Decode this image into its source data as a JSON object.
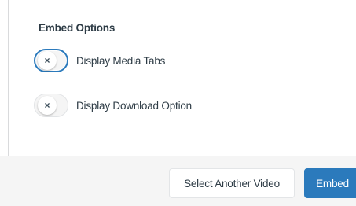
{
  "embed_options": {
    "title": "Embed Options",
    "options": [
      {
        "label": "Display Media Tabs",
        "toggle_icon": "x-icon",
        "toggle_glyph": "×",
        "checked": false,
        "focused": true
      },
      {
        "label": "Display Download Option",
        "toggle_icon": "x-icon",
        "toggle_glyph": "×",
        "checked": false,
        "focused": false
      }
    ]
  },
  "footer": {
    "select_another_label": "Select Another Video",
    "embed_label": "Embed"
  },
  "colors": {
    "accent": "#2b7abc",
    "text": "#2d3b45",
    "footer_bg": "#f5f5f5"
  }
}
